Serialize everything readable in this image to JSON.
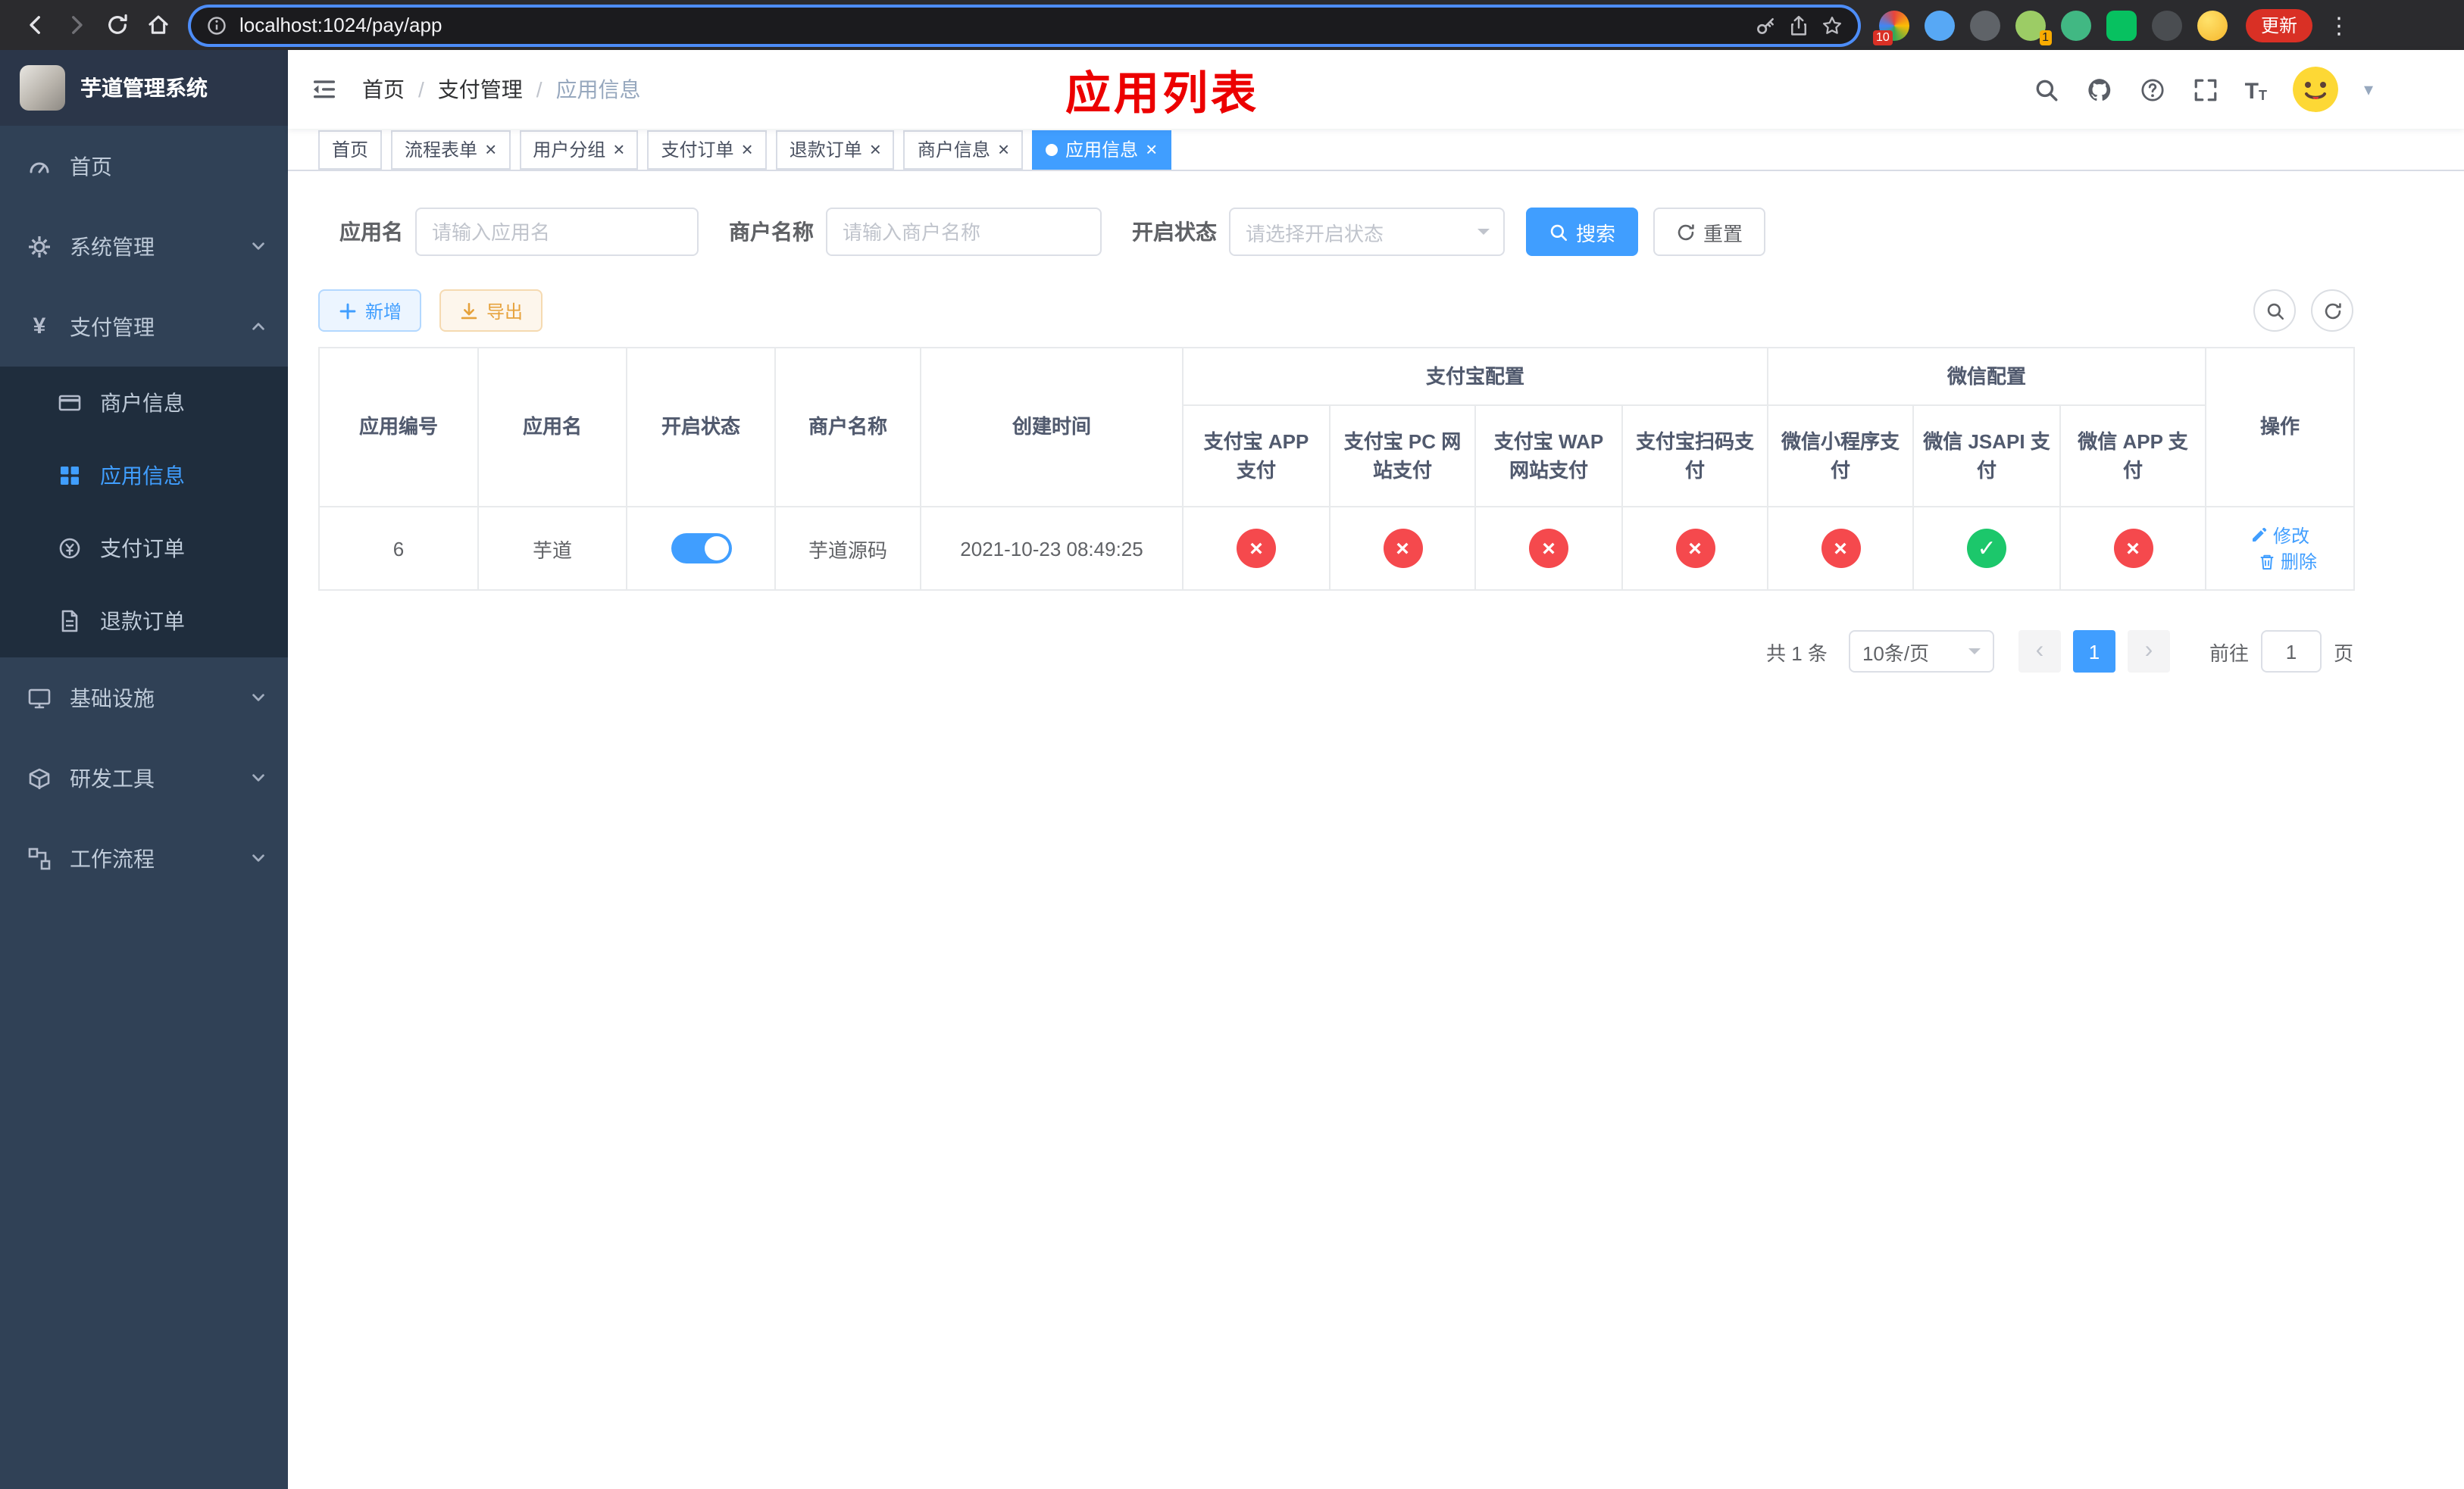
{
  "browser": {
    "url": "localhost:1024/pay/app",
    "update_label": "更新",
    "extension_badge_1": "10",
    "extension_badge_2": "1"
  },
  "glyphs": {
    "close": "×",
    "cross": "×",
    "check": "✓",
    "slash": "/",
    "prev": "‹",
    "next": "›",
    "dots": "⋮",
    "caret": "▾",
    "yen": "¥",
    "font_icon": "T"
  },
  "sidebar": {
    "title": "芋道管理系统",
    "items": [
      {
        "label": "首页",
        "icon": "dashboard-icon"
      },
      {
        "label": "系统管理",
        "icon": "gear-icon",
        "expandable": true
      },
      {
        "label": "支付管理",
        "icon": "yen-icon",
        "expandable": true,
        "expanded": true,
        "children": [
          {
            "label": "商户信息",
            "icon": "card-icon"
          },
          {
            "label": "应用信息",
            "icon": "grid-icon",
            "active": true
          },
          {
            "label": "支付订单",
            "icon": "order-icon"
          },
          {
            "label": "退款订单",
            "icon": "document-icon"
          }
        ]
      },
      {
        "label": "基础设施",
        "icon": "monitor-icon",
        "expandable": true
      },
      {
        "label": "研发工具",
        "icon": "toolbox-icon",
        "expandable": true
      },
      {
        "label": "工作流程",
        "icon": "workflow-icon",
        "expandable": true
      }
    ]
  },
  "header": {
    "breadcrumb": [
      "首页",
      "支付管理",
      "应用信息"
    ],
    "annotation": "应用列表"
  },
  "tabs": [
    {
      "label": "首页",
      "closable": false,
      "active": false
    },
    {
      "label": "流程表单",
      "closable": true,
      "active": false
    },
    {
      "label": "用户分组",
      "closable": true,
      "active": false
    },
    {
      "label": "支付订单",
      "closable": true,
      "active": false
    },
    {
      "label": "退款订单",
      "closable": true,
      "active": false
    },
    {
      "label": "商户信息",
      "closable": true,
      "active": false
    },
    {
      "label": "应用信息",
      "closable": true,
      "active": true
    }
  ],
  "filters": {
    "app_name_label": "应用名",
    "app_name_placeholder": "请输入应用名",
    "merchant_label": "商户名称",
    "merchant_placeholder": "请输入商户名称",
    "status_label": "开启状态",
    "status_placeholder": "请选择开启状态",
    "search_button": "搜索",
    "reset_button": "重置"
  },
  "toolbar": {
    "add_button": "新增",
    "export_button": "导出"
  },
  "table": {
    "headers": {
      "app_id": "应用编号",
      "app_name": "应用名",
      "status": "开启状态",
      "merchant": "商户名称",
      "created": "创建时间",
      "alipay_group": "支付宝配置",
      "alipay_app": "支付宝 APP 支付",
      "alipay_pc": "支付宝 PC 网站支付",
      "alipay_wap": "支付宝 WAP 网站支付",
      "alipay_qr": "支付宝扫码支付",
      "wechat_group": "微信配置",
      "wechat_mini": "微信小程序支付",
      "wechat_jsapi": "微信 JSAPI 支付",
      "wechat_app": "微信 APP 支付",
      "actions": "操作"
    },
    "rows": [
      {
        "app_id": "6",
        "app_name": "芋道",
        "status_on": true,
        "merchant": "芋道源码",
        "created": "2021-10-23 08:49:25",
        "alipay_app": false,
        "alipay_pc": false,
        "alipay_wap": false,
        "alipay_qr": false,
        "wechat_mini": false,
        "wechat_jsapi": true,
        "wechat_app": false,
        "edit_label": "修改",
        "delete_label": "删除"
      }
    ]
  },
  "pagination": {
    "total": "共 1 条",
    "page_size": "10条/页",
    "current_page": "1",
    "goto_label": "前往",
    "goto_value": "1",
    "unit_label": "页"
  },
  "colors": {
    "primary": "#409EFF",
    "tab-active": "#409EFF",
    "cross-red": "#f5494d",
    "check-green": "#1cc76b",
    "title-red": "#ec0000",
    "sidebar-bg": "#304156",
    "submenu-bg": "#1f2d3d"
  }
}
